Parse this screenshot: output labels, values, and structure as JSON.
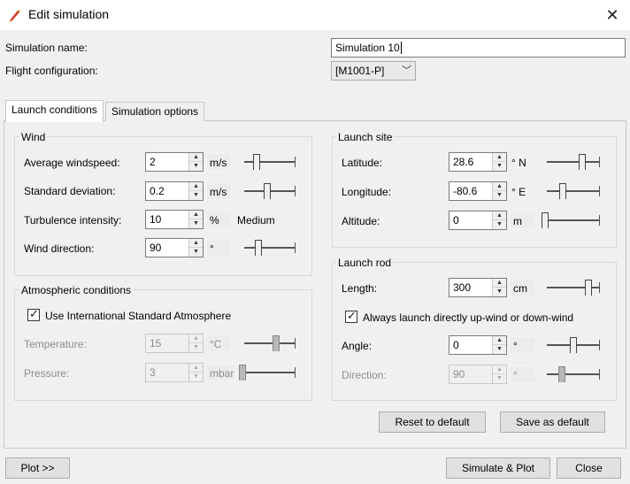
{
  "window": {
    "title": "Edit simulation",
    "close_icon": "close-icon",
    "app_icon": "rocket-icon"
  },
  "header": {
    "sim_name_label": "Simulation name:",
    "sim_name_value": "Simulation 10",
    "flight_config_label": "Flight configuration:",
    "flight_config_value": "[M1001-P]"
  },
  "tabs": [
    {
      "label": "Launch conditions",
      "active": true
    },
    {
      "label": "Simulation options",
      "active": false
    }
  ],
  "wind": {
    "title": "Wind",
    "avg_label": "Average windspeed:",
    "avg_value": "2",
    "avg_unit": "m/s",
    "avg_slider": 0.2,
    "std_label": "Standard deviation:",
    "std_value": "0.2",
    "std_unit": "m/s",
    "std_slider": 0.45,
    "turb_label": "Turbulence intensity:",
    "turb_value": "10",
    "turb_unit": "%",
    "turb_desc": "Medium",
    "dir_label": "Wind direction:",
    "dir_value": "90",
    "dir_unit": "°",
    "dir_slider": 0.25
  },
  "atmosphere": {
    "title": "Atmospheric conditions",
    "isa_label": "Use International Standard Atmosphere",
    "isa_checked": true,
    "temp_label": "Temperature:",
    "temp_value": "15",
    "temp_unit": "°C",
    "temp_slider": 0.65,
    "press_label": "Pressure:",
    "press_value": "3",
    "press_unit": "mbar",
    "press_slider": 0.0
  },
  "launch_site": {
    "title": "Launch site",
    "lat_label": "Latitude:",
    "lat_value": "28.6",
    "lat_unit": "° N",
    "lat_slider": 0.7,
    "lon_label": "Longitude:",
    "lon_value": "-80.6",
    "lon_unit": "° E",
    "lon_slider": 0.27,
    "alt_label": "Altitude:",
    "alt_value": "0",
    "alt_unit": "m",
    "alt_slider": 0.0
  },
  "launch_rod": {
    "title": "Launch rod",
    "len_label": "Length:",
    "len_value": "300",
    "len_unit": "cm",
    "len_slider": 0.85,
    "updown_label": "Always launch directly up-wind or down-wind",
    "updown_checked": true,
    "angle_label": "Angle:",
    "angle_value": "0",
    "angle_unit": "°",
    "angle_slider": 0.5,
    "dir_label": "Direction:",
    "dir_value": "90",
    "dir_unit": "°",
    "dir_slider": 0.25
  },
  "buttons": {
    "reset": "Reset to default",
    "save_default": "Save as default",
    "plot": "Plot >>",
    "simulate_plot": "Simulate & Plot",
    "close": "Close"
  }
}
